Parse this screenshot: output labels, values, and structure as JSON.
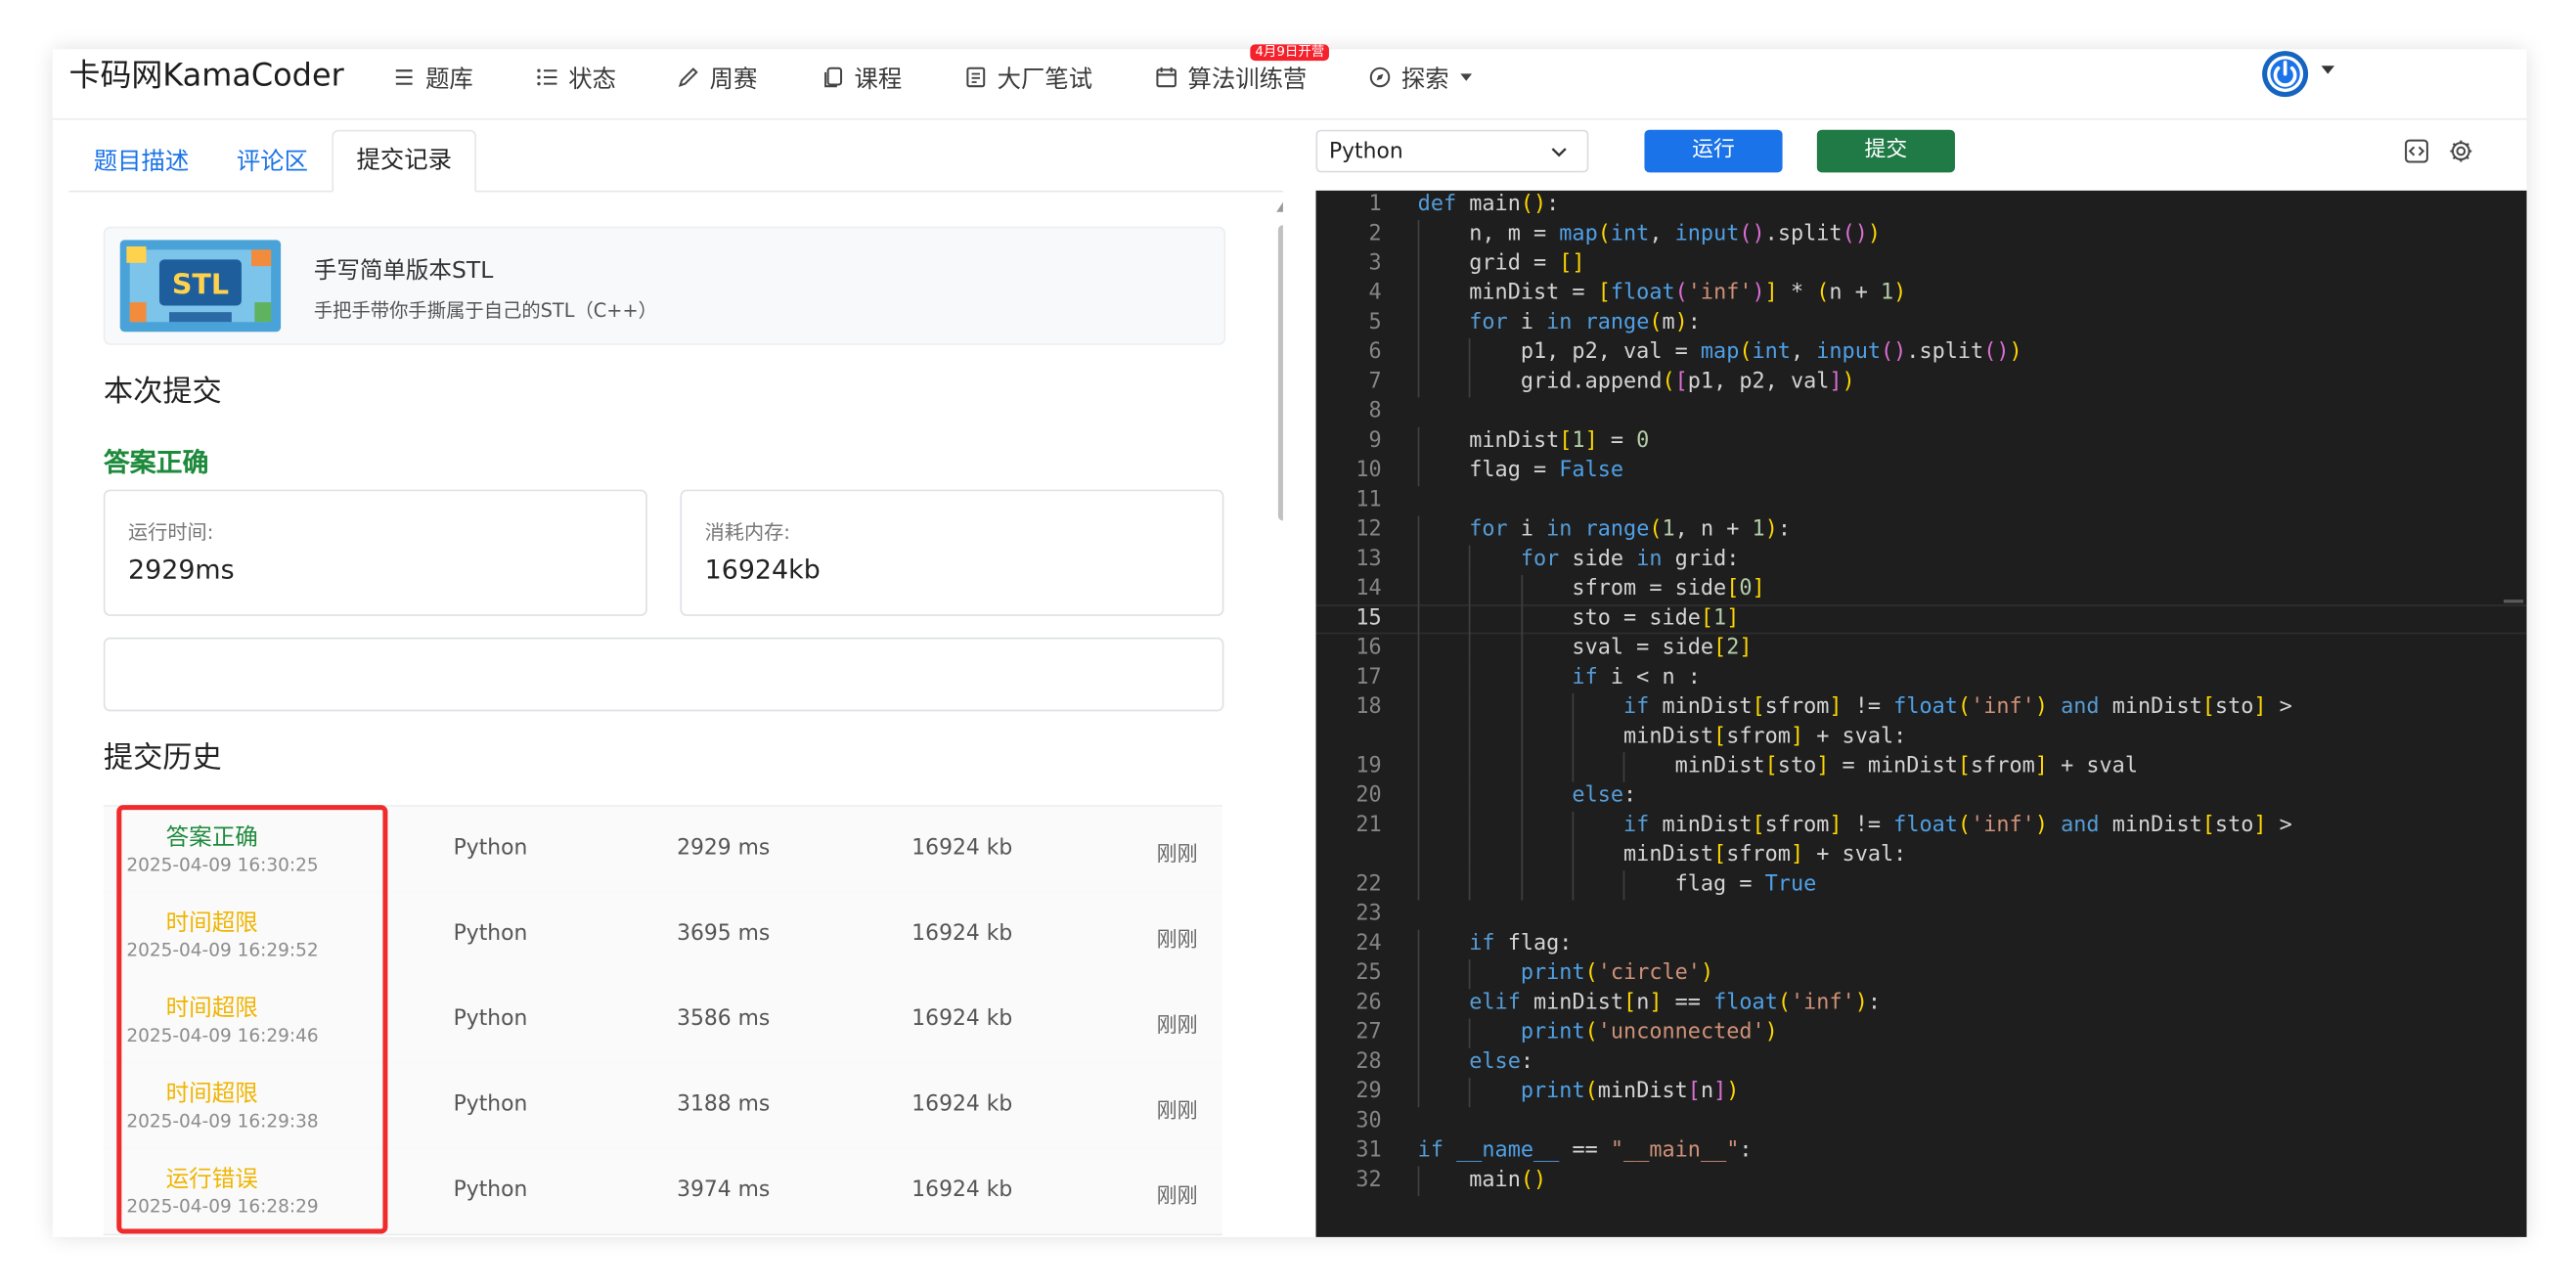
{
  "header": {
    "brand": "卡码网KamaCoder",
    "nav": [
      {
        "label": "题库",
        "icon": "list-icon"
      },
      {
        "label": "状态",
        "icon": "bullet-list-icon"
      },
      {
        "label": "周赛",
        "icon": "pencil-icon"
      },
      {
        "label": "课程",
        "icon": "copy-icon"
      },
      {
        "label": "大厂笔试",
        "icon": "document-icon"
      },
      {
        "label": "算法训练营",
        "icon": "calendar-icon",
        "badge": "4月9日开营"
      },
      {
        "label": "探索",
        "icon": "compass-icon"
      }
    ],
    "user_icon": "power-icon",
    "accent": "#1a73e8"
  },
  "tabs": [
    {
      "label": "题目描述",
      "active": false
    },
    {
      "label": "评论区",
      "active": false
    },
    {
      "label": "提交记录",
      "active": true
    }
  ],
  "promo": {
    "title": "手写简单版本STL",
    "subtitle": "手把手带你手撕属于自己的STL（C++）",
    "thumb_text": "STL"
  },
  "submission": {
    "heading": "本次提交",
    "result": "答案正确",
    "result_color": "#1e8a3c",
    "runtime_label": "运行时间:",
    "runtime_value": "2929ms",
    "memory_label": "消耗内存:",
    "memory_value": "16924kb"
  },
  "history": {
    "heading": "提交历史",
    "rows": [
      {
        "status": "答案正确",
        "status_type": "ok",
        "time": "2025-04-09 16:30:25",
        "lang": "Python",
        "runtime": "2929 ms",
        "memory": "16924 kb",
        "when": "刚刚"
      },
      {
        "status": "时间超限",
        "status_type": "warn",
        "time": "2025-04-09 16:29:52",
        "lang": "Python",
        "runtime": "3695 ms",
        "memory": "16924 kb",
        "when": "刚刚"
      },
      {
        "status": "时间超限",
        "status_type": "warn",
        "time": "2025-04-09 16:29:46",
        "lang": "Python",
        "runtime": "3586 ms",
        "memory": "16924 kb",
        "when": "刚刚"
      },
      {
        "status": "时间超限",
        "status_type": "warn",
        "time": "2025-04-09 16:29:38",
        "lang": "Python",
        "runtime": "3188 ms",
        "memory": "16924 kb",
        "when": "刚刚"
      },
      {
        "status": "运行错误",
        "status_type": "warn",
        "time": "2025-04-09 16:28:29",
        "lang": "Python",
        "runtime": "3974 ms",
        "memory": "16924 kb",
        "when": "刚刚"
      }
    ]
  },
  "editor_toolbar": {
    "language": "Python",
    "run_label": "运行",
    "submit_label": "提交",
    "run_color": "#1a73e8",
    "submit_color": "#1f7a45",
    "icons": [
      "code-icon",
      "gear-icon"
    ]
  },
  "editor": {
    "current_line": 15,
    "lines": [
      "def main():",
      "    n, m = map(int, input().split())",
      "    grid = []",
      "    minDist = [float('inf')] * (n + 1)",
      "    for i in range(m):",
      "        p1, p2, val = map(int, input().split())",
      "        grid.append([p1, p2, val])",
      "",
      "    minDist[1] = 0",
      "    flag = False",
      "",
      "    for i in range(1, n + 1):",
      "        for side in grid:",
      "            sfrom = side[0]",
      "            sto = side[1]",
      "            sval = side[2]",
      "            if i < n :",
      "                if minDist[sfrom] != float('inf') and minDist[sto] > minDist[sfrom] + sval:",
      "                    minDist[sto] = minDist[sfrom] + sval",
      "            else:",
      "                if minDist[sfrom] != float('inf') and minDist[sto] > minDist[sfrom] + sval:",
      "                    flag = True",
      "",
      "    if flag:",
      "        print('circle')",
      "    elif minDist[n] == float('inf'):",
      "        print('unconnected')",
      "    else:",
      "        print(minDist[n])",
      "",
      "if __name__ == \"__main__\":",
      "    main()"
    ]
  }
}
